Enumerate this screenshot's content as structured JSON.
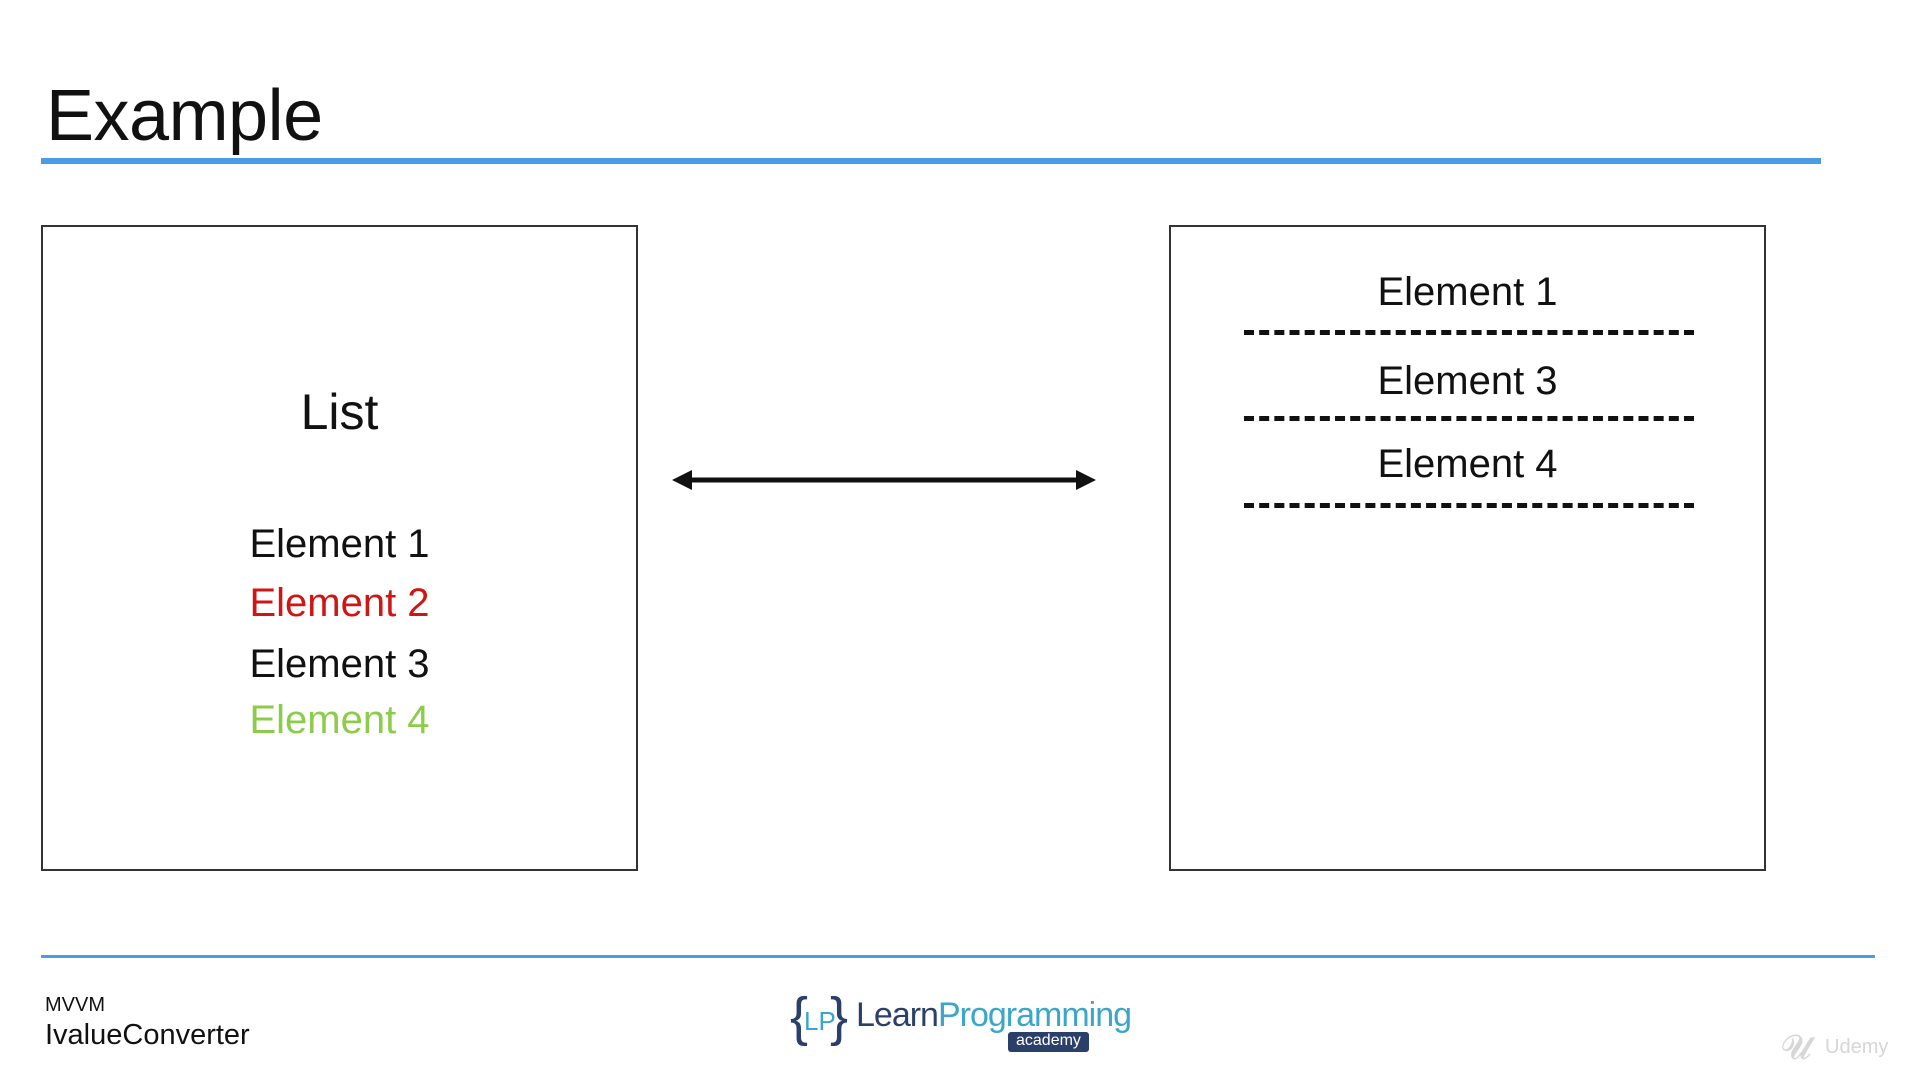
{
  "slide": {
    "title": "Example"
  },
  "left_panel": {
    "title": "List",
    "items": [
      {
        "label": "Element 1",
        "color": "#111111"
      },
      {
        "label": "Element 2",
        "color": "#d01515"
      },
      {
        "label": "Element 3",
        "color": "#111111"
      },
      {
        "label": "Element 4",
        "color": "#8ccc4a"
      }
    ]
  },
  "right_panel": {
    "items": [
      {
        "label": "Element 1"
      },
      {
        "label": "Element 3"
      },
      {
        "label": "Element 4"
      }
    ]
  },
  "connector": {
    "type": "double-arrow",
    "color": "#111111"
  },
  "footer": {
    "topic": "MVVM",
    "subtitle": "IvalueConverter",
    "logo": {
      "open_brace": "{",
      "initials": "LP",
      "close_brace": "}",
      "learn": "Learn",
      "programming": "Programming",
      "academy": "academy"
    },
    "watermark": {
      "icon": "udemy-icon",
      "text": "Udemy"
    }
  },
  "colors": {
    "accent": "#4a9be8",
    "border": "#333333",
    "red": "#d01515",
    "green": "#8ccc4a"
  }
}
